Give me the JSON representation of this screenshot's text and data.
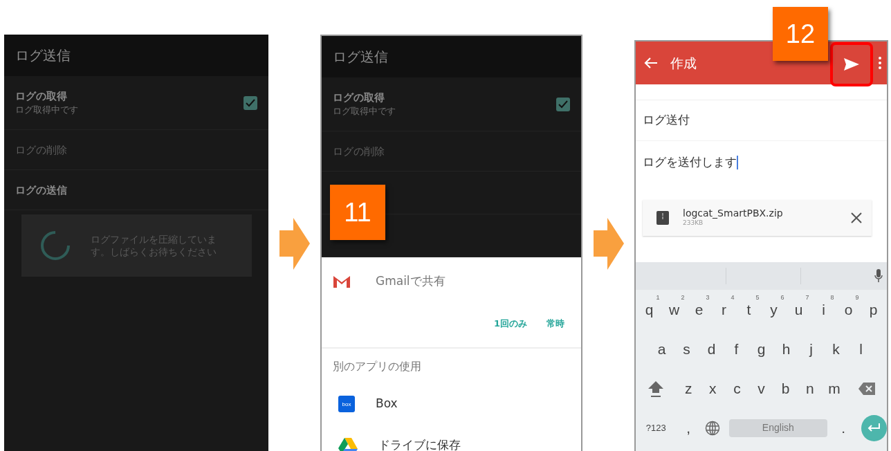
{
  "step_1": {
    "title": "ログ送信",
    "items": [
      {
        "label": "ログの取得",
        "sublabel": "ログ取得中です",
        "checked": true,
        "disabled": false
      },
      {
        "label": "ログの削除",
        "disabled": true
      },
      {
        "label": "ログの送信",
        "disabled": false
      }
    ],
    "progress_dialog": {
      "message": "ログファイルを圧縮しています。しばらくお待ちください"
    }
  },
  "step_2": {
    "step_badge": "11",
    "title": "ログ送信",
    "items": [
      {
        "label": "ログの取得",
        "sublabel": "ログ取得中です",
        "checked": true,
        "disabled": false
      },
      {
        "label": "ログの削除",
        "disabled": true
      }
    ],
    "share_sheet": {
      "default_app": {
        "kind": "gmail",
        "label": "Gmailで共有"
      },
      "actions": [
        "1回のみ",
        "常時"
      ],
      "section_header": "別のアプリの使用",
      "apps": [
        {
          "kind": "box",
          "label": "Box"
        },
        {
          "kind": "drive",
          "label": "ドライブに保存"
        }
      ]
    }
  },
  "step_3": {
    "step_badge": "12",
    "title": "作成",
    "send_highlighted": true,
    "subject": "ログ送付",
    "body": "ログを送付します",
    "attachment": {
      "name": "logcat_SmartPBX.zip",
      "size": "233KB"
    },
    "keyboard": {
      "letter_rows": [
        {
          "keys": [
            {
              "kind": "char",
              "label": "q",
              "hint": "1"
            },
            {
              "kind": "char",
              "label": "w",
              "hint": "2"
            },
            {
              "kind": "char",
              "label": "e",
              "hint": "3"
            },
            {
              "kind": "char",
              "label": "r",
              "hint": "4"
            },
            {
              "kind": "char",
              "label": "t",
              "hint": "5"
            },
            {
              "kind": "char",
              "label": "y",
              "hint": "6"
            },
            {
              "kind": "char",
              "label": "u",
              "hint": "7"
            },
            {
              "kind": "char",
              "label": "i",
              "hint": "8"
            },
            {
              "kind": "char",
              "label": "o",
              "hint": "9"
            },
            {
              "kind": "char",
              "label": "p"
            }
          ]
        },
        {
          "keys": [
            {
              "kind": "char",
              "label": "a"
            },
            {
              "kind": "char",
              "label": "s"
            },
            {
              "kind": "char",
              "label": "d"
            },
            {
              "kind": "char",
              "label": "f"
            },
            {
              "kind": "char",
              "label": "g"
            },
            {
              "kind": "char",
              "label": "h"
            },
            {
              "kind": "char",
              "label": "j"
            },
            {
              "kind": "char",
              "label": "k"
            },
            {
              "kind": "char",
              "label": "l"
            }
          ]
        },
        {
          "keys": [
            {
              "kind": "shift"
            },
            {
              "kind": "char",
              "label": "z"
            },
            {
              "kind": "char",
              "label": "x"
            },
            {
              "kind": "char",
              "label": "c"
            },
            {
              "kind": "char",
              "label": "v"
            },
            {
              "kind": "char",
              "label": "b"
            },
            {
              "kind": "char",
              "label": "n"
            },
            {
              "kind": "char",
              "label": "m"
            },
            {
              "kind": "backspace"
            }
          ]
        }
      ],
      "bottom_row": {
        "symbols_key": "?123",
        "comma_key": ",",
        "space_bar": "English",
        "period_key": "."
      }
    }
  }
}
